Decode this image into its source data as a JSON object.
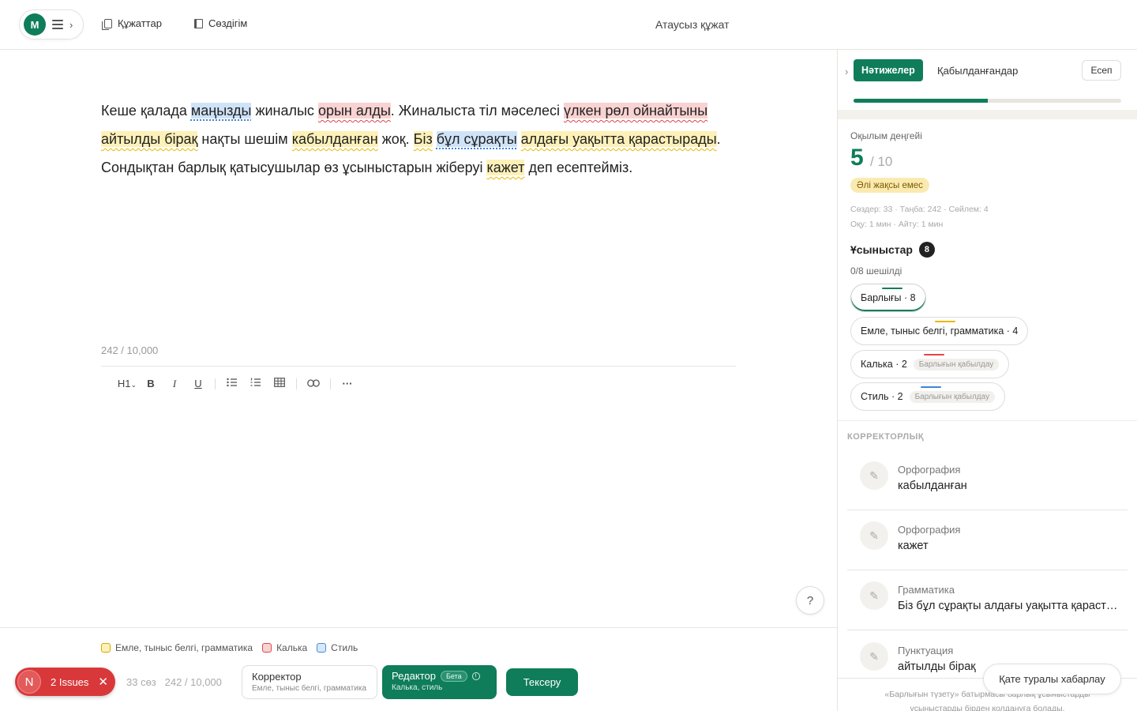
{
  "header": {
    "avatar_letter": "M",
    "nav_documents": "Құжаттар",
    "nav_dictionary": "Сөздігім",
    "document_title": "Атаусыз құжат"
  },
  "editor": {
    "segments": [
      {
        "t": "Кеше қалада ",
        "h": ""
      },
      {
        "t": "маңызды",
        "h": "b"
      },
      {
        "t": " жиналыс ",
        "h": ""
      },
      {
        "t": "орын алды",
        "h": "r"
      },
      {
        "t": ". Жиналыста тіл мәселесі ",
        "h": ""
      },
      {
        "t": "үлкен рөл ойнайтыны",
        "h": "r"
      },
      {
        "t": " ",
        "h": ""
      },
      {
        "t": "айтылды бірақ",
        "h": "y"
      },
      {
        "t": " нақты шешім ",
        "h": ""
      },
      {
        "t": "кабылданған",
        "h": "y"
      },
      {
        "t": " жоқ. ",
        "h": ""
      },
      {
        "t": "Біз",
        "h": "y"
      },
      {
        "t": " ",
        "h": ""
      },
      {
        "t": "бұл сұрақты",
        "h": "b"
      },
      {
        "t": " ",
        "h": ""
      },
      {
        "t": "алдағы уақытта қарастырады",
        "h": "y"
      },
      {
        "t": ". Сондықтан барлық қатысушылар өз ұсыныстарын жіберуі ",
        "h": ""
      },
      {
        "t": "кажет",
        "h": "y"
      },
      {
        "t": " деп есептейміз.",
        "h": ""
      }
    ],
    "char_count": "242 / 10,000",
    "toolbar": {
      "heading": "H1",
      "bold": "B",
      "italic": "I",
      "underline": "U"
    },
    "help_label": "?"
  },
  "bottom": {
    "legend": [
      {
        "label": "Емле, тыныс белгі, грамматика",
        "color": "#fdf1b8"
      },
      {
        "label": "Калька",
        "color": "#f9d2d2"
      },
      {
        "label": "Стиль",
        "color": "#d6e8fb"
      }
    ],
    "issues_badge": {
      "letter": "N",
      "label": "2 Issues"
    },
    "word_count": "33 сөз",
    "char_count": "242 / 10,000",
    "mode_corrector": {
      "title": "Корректор",
      "subtitle": "Емле, тыныс белгі, грамматика"
    },
    "mode_editor": {
      "title": "Редактор",
      "beta": "Бета",
      "subtitle": "Калька, стиль"
    },
    "check_label": "Тексеру"
  },
  "panel": {
    "tab_results": "Нәтижелер",
    "tab_accepted": "Қабылданғандар",
    "report_button": "Есеп",
    "progress_fraction": 0.5,
    "readability_label": "Оқылым деңгейі",
    "readability_score": "5",
    "readability_max": "/ 10",
    "readability_verdict": "Әлі жақсы емес",
    "stats_line1": "Сөздер: 33 · Таңба: 242 · Сөйлем: 4",
    "stats_line2": "Оқу: 1 мин · Айту: 1 мин",
    "suggestions_title": "Ұсыныстар",
    "suggestions_count": "8",
    "resolved_text": "0/8 шешілді",
    "chips": [
      {
        "label": "Барлығы  · 8",
        "color": "#0f7d59",
        "accept": ""
      },
      {
        "label": "Емле, тыныс белгі, грамматика · 4",
        "color": "#e6b800",
        "accept": ""
      },
      {
        "label": "Калька · 2",
        "color": "#e0454a",
        "accept": "Барлығын қабылдау"
      },
      {
        "label": "Стиль · 2",
        "color": "#3f84d6",
        "accept": "Барлығын қабылдау"
      }
    ],
    "section_label": "КОРРЕКТОРЛЫҚ",
    "issues": [
      {
        "category": "Орфография",
        "text": "кабылданған"
      },
      {
        "category": "Орфография",
        "text": "кажет"
      },
      {
        "category": "Грамматика",
        "text": "Біз бұл сұрақты алдағы уақытта қарастырады"
      },
      {
        "category": "Пунктуация",
        "text": "айтылды бірақ"
      }
    ],
    "report_issue_button": "Қате туралы хабарлау",
    "footer_line1": "«Барлығын түзету» батырмасы барлық ұсыныстарды",
    "footer_line2": "ұсыныстарды бірден қолдануға болады."
  }
}
